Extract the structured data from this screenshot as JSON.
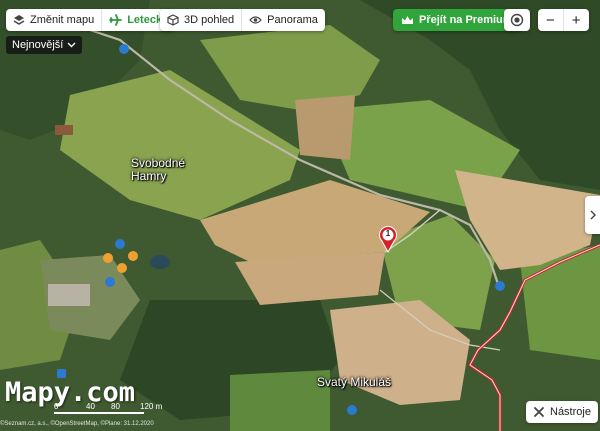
{
  "toolbar": {
    "change_map_label": "Změnit mapu",
    "aerial_label": "Letecká",
    "view3d_label": "3D pohled",
    "panorama_label": "Panorama",
    "premium_label": "Přejít na Premium",
    "zoom_out_label": "−",
    "zoom_in_label": "+"
  },
  "filter": {
    "label": "Nejnovější"
  },
  "places": [
    {
      "name": "Svobodné\nHamry"
    },
    {
      "name": "Svatý Mikuláš"
    }
  ],
  "marker": {
    "number": "1"
  },
  "watermark": "Mapy.com",
  "scale": {
    "labels": [
      "0",
      "40",
      "80",
      "120 m"
    ]
  },
  "copyright": "©Seznam.cz, a.s., ©OpenStreetMap, ©Plane: 31.12.2020",
  "tools": {
    "label": "Nástroje"
  },
  "colors": {
    "accent_green": "#2fa53b",
    "route_red": "#c8282d",
    "marker_red": "#d2232a"
  }
}
